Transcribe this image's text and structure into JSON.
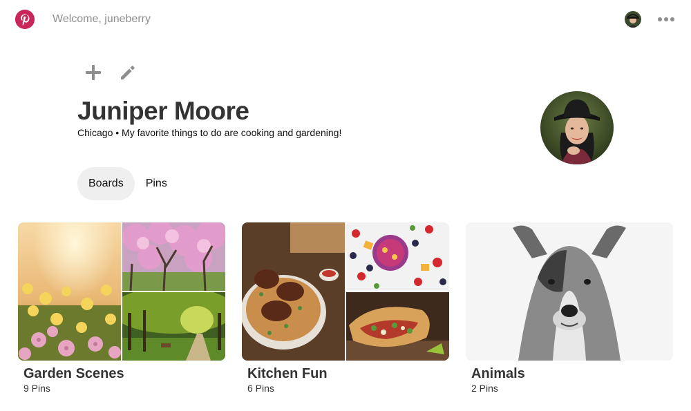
{
  "header": {
    "welcome_text": "Welcome, juneberry",
    "logo_icon": "pinterest-logo",
    "more_icon": "more-dots-icon",
    "brand_color": "#c9275a"
  },
  "profile": {
    "name": "Juniper Moore",
    "bio": "Chicago • My favorite things to do are cooking and gardening!",
    "actions": [
      {
        "icon": "plus-icon"
      },
      {
        "icon": "pencil-icon"
      }
    ]
  },
  "tabs": [
    {
      "label": "Boards",
      "active": true
    },
    {
      "label": "Pins",
      "active": false
    }
  ],
  "boards": [
    {
      "title": "Garden Scenes",
      "count": "9 Pins"
    },
    {
      "title": "Kitchen Fun",
      "count": "6 Pins"
    },
    {
      "title": "Animals",
      "count": "2 Pins"
    }
  ]
}
